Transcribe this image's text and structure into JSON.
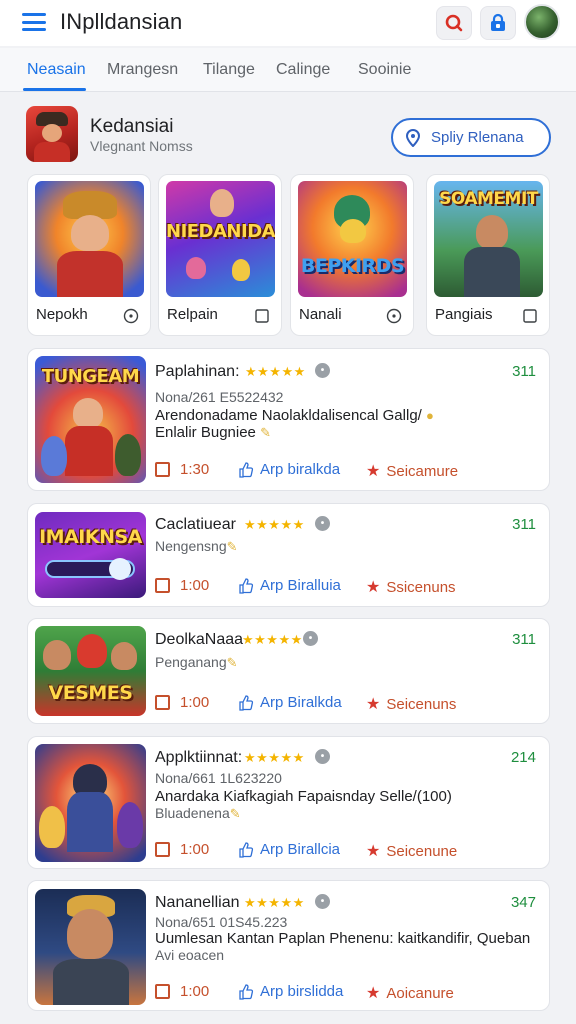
{
  "header": {
    "title": "INplldansian",
    "icons": [
      "search-icon",
      "lock-icon",
      "avatar"
    ]
  },
  "tabs": [
    {
      "label": "Neasain",
      "active": true
    },
    {
      "label": "Mrangesn",
      "active": false
    },
    {
      "label": "Tilange",
      "active": false
    },
    {
      "label": "Calinge",
      "active": false
    },
    {
      "label": "Sooinie",
      "active": false
    }
  ],
  "featured": {
    "title": "Kedansiai",
    "subtitle": "Vlegnant Nomss",
    "button_label": "Spliy Rlenana",
    "cards": [
      {
        "name": "Nepokh",
        "thumb_text": "",
        "icon": "info-circle-icon"
      },
      {
        "name": "Relpain",
        "thumb_text": "NIEDANIDAI",
        "icon": "checkbox-icon"
      },
      {
        "name": "Nanali",
        "thumb_text": "BEPKIRDS",
        "icon": "info-circle-icon"
      },
      {
        "name": "Pangiais",
        "thumb_text": "SOAMEMIT",
        "icon": "checkbox-icon"
      }
    ]
  },
  "list": [
    {
      "thumb_text": "TUNGEAM",
      "name": "Paplahinan:",
      "stars": "★★★★★",
      "count": "311",
      "meta": "Nona/261 E5522432",
      "desc": "Arendonadame Naolakldalisencal Gallg/",
      "desc2": "Enlalir Bugniee",
      "time": "1:30",
      "app_label": "Arp biralkda",
      "star_label": "Seicamure"
    },
    {
      "thumb_text": "IMAIKNSA",
      "name": "Caclatiuear",
      "stars": "★★★★★",
      "count": "311",
      "meta": "Nengensng",
      "desc": "",
      "desc2": "",
      "time": "1:00",
      "app_label": "Arp Biralluia",
      "star_label": "Ssicenuns"
    },
    {
      "thumb_text": "VESMES",
      "name": "DeolkaNaaa",
      "stars": "★★★★★",
      "count": "311",
      "meta": "Penganang",
      "desc": "",
      "desc2": "",
      "time": "1:00",
      "app_label": "Arp Biralkda",
      "star_label": "Seicenuns"
    },
    {
      "thumb_text": "",
      "name": "Applktiinnat:",
      "stars": "★★★★★",
      "count": "214",
      "meta": "Nona/661 1L623220",
      "desc": "Anardaka Kiafkagiah Fapaisnday Selle/(100)",
      "desc2": "Bluadenena",
      "time": "1:00",
      "app_label": "Arp Birallcia",
      "star_label": "Seicenune"
    },
    {
      "thumb_text": "",
      "name": "Nananellian",
      "stars": "★★★★★",
      "count": "347",
      "meta": "Nona/651 01S45.223",
      "desc": "Uumlesan Kantan Paplan Phenenu: kaitkandifir, Queban",
      "desc2": "Avi eoacen",
      "time": "1:00",
      "app_label": "Arp birslidda",
      "star_label": "Aoicanure"
    }
  ],
  "colors": {
    "accent": "#1a73e8",
    "count_green": "#1e8e3e",
    "action_orange": "#c5502c",
    "star_gold": "#f4b400"
  }
}
